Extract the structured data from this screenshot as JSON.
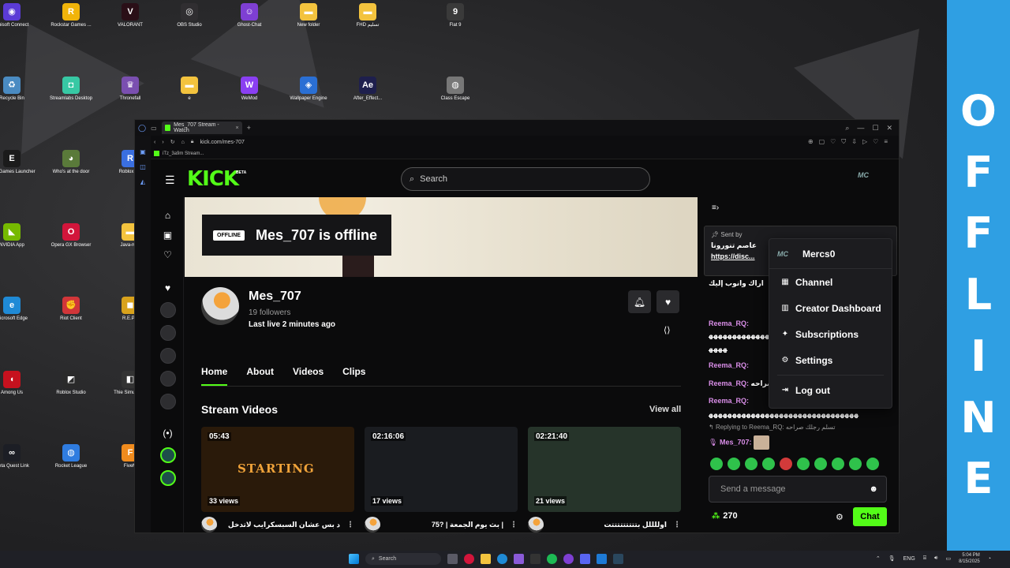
{
  "desktop": {
    "icons": [
      {
        "label": "Ubisoft Connect",
        "glyph": "◉",
        "color": "#5b3bd6"
      },
      {
        "label": "Rockstar Games ...",
        "glyph": "R",
        "color": "#f1b40a"
      },
      {
        "label": "VALORANT",
        "glyph": "V",
        "color": "#2a0f17"
      },
      {
        "label": "OBS Studio",
        "glyph": "◎",
        "color": "#302e31"
      },
      {
        "label": "Ghost-Chat",
        "glyph": "☺",
        "color": "#7e3fd3"
      },
      {
        "label": "New folder",
        "glyph": "▬",
        "color": "#f3c33e"
      },
      {
        "label": "FHD تسليم",
        "glyph": "▬",
        "color": "#f3c33e"
      },
      {
        "label": "Flat 9",
        "glyph": "9",
        "color": "#3a3a3a"
      },
      {
        "label": "Recycle Bin",
        "glyph": "♻",
        "color": "#4a8bc2"
      },
      {
        "label": "Streamlabs Desktop",
        "glyph": "◘",
        "color": "#37c8a4"
      },
      {
        "label": "Thronefall",
        "glyph": "♛",
        "color": "#7a4fb0"
      },
      {
        "label": "e",
        "glyph": "▬",
        "color": "#f3c33e"
      },
      {
        "label": "WeMod",
        "glyph": "W",
        "color": "#8a3ff2"
      },
      {
        "label": "Wallpaper Engine",
        "glyph": "◈",
        "color": "#2a6fd4"
      },
      {
        "label": "After_Effect...",
        "glyph": "Ae",
        "color": "#1e1f4d"
      },
      {
        "label": "Class Escape",
        "glyph": "◍",
        "color": "#777777"
      },
      {
        "label": "Epic Games Launcher",
        "glyph": "E",
        "color": "#1b1b1b"
      },
      {
        "label": "Who's at the door",
        "glyph": "◕",
        "color": "#5a7a3a"
      },
      {
        "label": "Roblox P...",
        "glyph": "R",
        "color": "#3a6fe0"
      },
      {
        "label": "NVIDIA App",
        "glyph": "◣",
        "color": "#76b900"
      },
      {
        "label": "Opera GX Browser",
        "glyph": "O",
        "color": "#d2153b"
      },
      {
        "label": "Java-ru...",
        "glyph": "▬",
        "color": "#f3c33e"
      },
      {
        "label": "Microsoft Edge",
        "glyph": "e",
        "color": "#1f8ad6"
      },
      {
        "label": "Riot Client",
        "glyph": "✊",
        "color": "#d13639"
      },
      {
        "label": "R.E.P...",
        "glyph": "◼",
        "color": "#d8a21c"
      },
      {
        "label": "Among Us",
        "glyph": "◖",
        "color": "#c6111e"
      },
      {
        "label": "Roblox Studio",
        "glyph": "◩",
        "color": "#2a2a2a"
      },
      {
        "label": "Thie Simulato...",
        "glyph": "◧",
        "color": "#333333"
      },
      {
        "label": "Meta Quest Link",
        "glyph": "∞",
        "color": "#1c1e25"
      },
      {
        "label": "Rocket League",
        "glyph": "◍",
        "color": "#2f7ce0"
      },
      {
        "label": "FiveM",
        "glyph": "F",
        "color": "#f08b1d"
      }
    ]
  },
  "offline_banner": [
    "O",
    "F",
    "F",
    "L",
    "I",
    "N",
    "E"
  ],
  "browser": {
    "tab_title": "Mes_707 Stream - Watch",
    "new_tab": "+",
    "url": "kick.com/mes-707",
    "bookmark": "iTz_3a9m Stream..."
  },
  "kick": {
    "logo": "KICK",
    "logo_beta": "BETA",
    "search_placeholder": "Search",
    "top_avatar": "MC",
    "offline_badge": "OFFLINE",
    "offline_title": "Mes_707 is offline",
    "channel": {
      "name": "Mes_707",
      "followers": "19 followers",
      "last_live": "Last live 2 minutes ago"
    },
    "tabs": [
      "Home",
      "About",
      "Videos",
      "Clips"
    ],
    "stream_videos_title": "Stream Videos",
    "view_all": "View all",
    "videos": [
      {
        "duration": "05:43",
        "views": "33 views",
        "title": "د بس عشان السبسكرايب لاتدخل",
        "thumb_text": "STARTING",
        "color": "#2a1a0a"
      },
      {
        "duration": "02:16:06",
        "views": "17 views",
        "title": "بث يوم الجمعة | ?75 |",
        "thumb_text": "",
        "color": "#1a1c20"
      },
      {
        "duration": "02:21:40",
        "views": "21 views",
        "title": "اوللللل بتتتتتتتتتت",
        "thumb_text": "",
        "color": "#26342a"
      }
    ]
  },
  "chat": {
    "pinned_by": "Sent by",
    "pinned_text": "عاصم تنورونا",
    "pinned_link": "https://disc...",
    "messages": [
      {
        "user": "",
        "text": "اراك وانوب إليك"
      },
      {
        "user": "Reema_RQ:",
        "text": ""
      },
      {
        "user": "",
        "text": "ﻬﻬﻬﻬﻬﻬﻬﻬﻬﻬﻬﻬﻬﻬﻬ"
      },
      {
        "user": "",
        "text": "ﻬﻬﻬﻬ"
      },
      {
        "user": "Reema_RQ:",
        "text": ""
      },
      {
        "user": "Reema_RQ:",
        "text": "تسلم رجلك صراحه"
      },
      {
        "user": "Reema_RQ:",
        "text": ""
      },
      {
        "user": "",
        "text": "ﻬﻬﻬﻬﻬﻬﻬﻬﻬﻬﻬﻬﻬﻬﻬﻬﻬﻬﻬﻬﻬﻬﻬﻬﻬﻬﻬﻬﻬﻬﻬﻬ"
      }
    ],
    "reply_to": "Replying to Reema_RQ: تسلم رجلك صراحه",
    "reply_user": "Mes_707:",
    "input_placeholder": "Send a message",
    "points": "270",
    "send_label": "Chat"
  },
  "user_menu": {
    "avatar": "MC",
    "username": "Mercs0",
    "items": [
      {
        "label": "Channel",
        "icon": "▦"
      },
      {
        "label": "Creator Dashboard",
        "icon": "▥"
      },
      {
        "label": "Subscriptions",
        "icon": "✦"
      },
      {
        "label": "Settings",
        "icon": "⚙"
      },
      {
        "label": "Log out",
        "icon": "⇥"
      }
    ]
  },
  "taskbar": {
    "search": "Search",
    "lang": "ENG",
    "time": "5:04 PM",
    "date": "8/15/2025"
  }
}
